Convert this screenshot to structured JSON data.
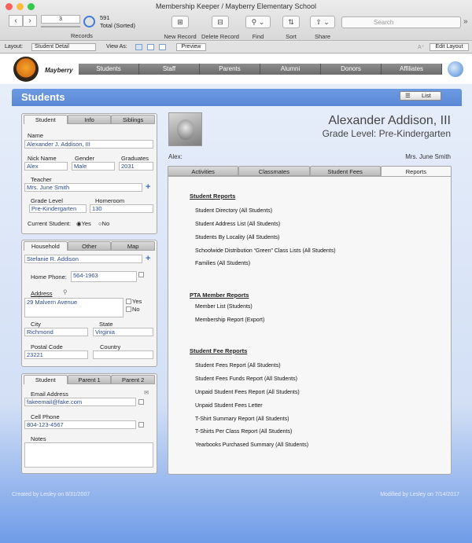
{
  "window": {
    "title": "Membership Keeper / Mayberry Elementary School"
  },
  "toolbar": {
    "record_field": "3",
    "record_count": "591",
    "record_total": "Total (Sorted)",
    "records_label": "Records",
    "new_record": "New Record",
    "delete_record": "Delete Record",
    "find": "Find",
    "sort": "Sort",
    "share": "Share",
    "search_placeholder": "Search"
  },
  "layoutbar": {
    "layout_label": "Layout:",
    "layout_value": "Student Detail",
    "viewas_label": "View As:",
    "preview": "Preview",
    "edit_layout": "Edit Layout"
  },
  "header": {
    "school": "Mayberry",
    "nav": [
      "Students",
      "Staff",
      "Parents",
      "Alumni",
      "Donors",
      "Affiliates"
    ]
  },
  "section": {
    "title": "Students",
    "list_button": "List"
  },
  "student_panel": {
    "tabs": [
      "Student",
      "Info",
      "Siblings"
    ],
    "name_label": "Name",
    "name": "Alexander J. Addison, III",
    "nick_label": "Nick Name",
    "nick": "Alex",
    "gender_label": "Gender",
    "gender": "Male",
    "graduates_label": "Graduates",
    "graduates": "2031",
    "teacher_label": "Teacher",
    "teacher": "Mrs. June Smith",
    "grade_label": "Grade Level",
    "grade": "Pre-Kindergarten",
    "homeroom_label": "Homeroom",
    "homeroom": "130",
    "current_label": "Current Student:",
    "yes": "Yes",
    "no": "No"
  },
  "household_panel": {
    "tabs": [
      "Household",
      "Other",
      "Map"
    ],
    "household": "Stefanie R. Addison",
    "home_phone_label": "Home Phone:",
    "home_phone": "564-1963",
    "address_label": "Address",
    "address": "29 Malvern Avenue",
    "yes": "Yes",
    "no": "No",
    "city_label": "City",
    "city": "Richmond",
    "state_label": "State",
    "state": "Virginia",
    "postal_label": "Postal Code",
    "postal": "23221",
    "country_label": "Country"
  },
  "contact_panel": {
    "tabs": [
      "Student",
      "Parent 1",
      "Parent 2"
    ],
    "email_label": "Email Address",
    "email": "fakeemail@fake.com",
    "cell_label": "Cell Phone",
    "cell": "804-123-4567",
    "notes_label": "Notes"
  },
  "profile": {
    "name": "Alexander Addison, III",
    "grade": "Grade Level: Pre-Kindergarten",
    "nick": "Alex:",
    "teacher": "Mrs. June Smith"
  },
  "reports": {
    "tabs": [
      "Activities",
      "Classmates",
      "Student Fees",
      "Reports"
    ],
    "sections": [
      {
        "title": "Student Reports",
        "items": [
          "Student Directory (All Students)",
          "Student Address List (All Students)",
          "Students By Locality (All Students)",
          "Schoolwide Distribution “Green” Class Lists (All Students)",
          "Families (All Students)"
        ]
      },
      {
        "title": "PTA Member Reports",
        "items": [
          "Member List (Students)",
          "Membership Report (Export)"
        ]
      },
      {
        "title": "Student Fee Reports",
        "items": [
          "Student Fees Report (All Students)",
          "Student Fees Funds Report (All Students)",
          "Unpaid Student Fees Report (All Students)",
          "Unpaid Student Fees Letter",
          "T-Shirt Summary Report (All Students)",
          "T-Shirts Per Class Report (All Students)",
          "Yearbooks Purchased Summary (All Students)"
        ]
      }
    ]
  },
  "footer": {
    "created": "Created by Lesley on 8/31/2007",
    "modified": "Modified by Lesley on 7/14/2017"
  }
}
